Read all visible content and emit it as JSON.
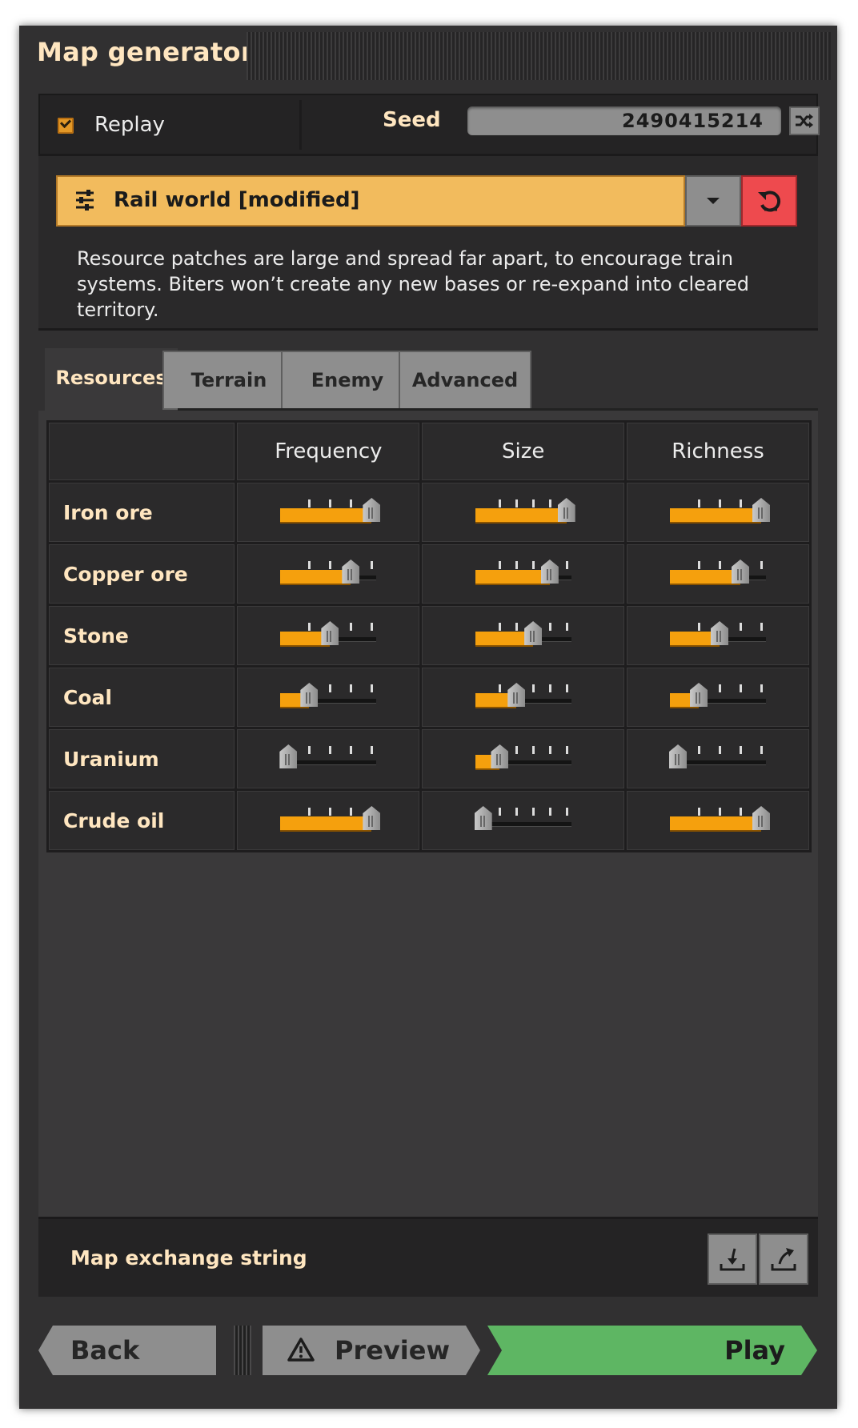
{
  "window": {
    "title": "Map generator"
  },
  "seed_row": {
    "replay_label": "Replay",
    "replay_checked": true,
    "seed_label": "Seed",
    "seed_value": "2490415214",
    "shuffle_icon": "shuffle-icon"
  },
  "preset": {
    "icon": "sliders-icon",
    "label": "Rail world [modified]",
    "dropdown_icon": "chevron-down-icon",
    "reset_icon": "reset-icon",
    "description": "Resource patches are large and spread far apart, to encourage train systems. Biters won’t create any new bases or re-expand into cleared territory."
  },
  "tabs": [
    {
      "label": "Resources",
      "active": true
    },
    {
      "label": "Terrain",
      "active": false
    },
    {
      "label": "Enemy",
      "active": false
    },
    {
      "label": "Advanced",
      "active": false
    }
  ],
  "resources": {
    "columns": [
      "Frequency",
      "Size",
      "Richness"
    ],
    "rows": [
      {
        "name": "Iron ore",
        "frequency": {
          "level": 4,
          "steps": 4
        },
        "size": {
          "level": 5,
          "steps": 5
        },
        "richness": {
          "level": 4,
          "steps": 4
        }
      },
      {
        "name": "Copper ore",
        "frequency": {
          "level": 3,
          "steps": 4
        },
        "size": {
          "level": 4,
          "steps": 5
        },
        "richness": {
          "level": 3,
          "steps": 4
        }
      },
      {
        "name": "Stone",
        "frequency": {
          "level": 2,
          "steps": 4
        },
        "size": {
          "level": 3,
          "steps": 5
        },
        "richness": {
          "level": 2,
          "steps": 4
        }
      },
      {
        "name": "Coal",
        "frequency": {
          "level": 1,
          "steps": 4
        },
        "size": {
          "level": 2,
          "steps": 5
        },
        "richness": {
          "level": 1,
          "steps": 4
        }
      },
      {
        "name": "Uranium",
        "frequency": {
          "level": 0,
          "steps": 4
        },
        "size": {
          "level": 1,
          "steps": 5
        },
        "richness": {
          "level": 0,
          "steps": 4
        }
      },
      {
        "name": "Crude oil",
        "frequency": {
          "level": 4,
          "steps": 4
        },
        "size": {
          "level": 0,
          "steps": 5
        },
        "richness": {
          "level": 4,
          "steps": 4
        }
      }
    ]
  },
  "exchange": {
    "label": "Map exchange string",
    "import_icon": "import-icon",
    "export_icon": "export-icon"
  },
  "buttons": {
    "back": "Back",
    "preview": "Preview",
    "preview_icon": "warning-icon",
    "play": "Play"
  },
  "colors": {
    "accent_orange": "#f5a00d",
    "preset_bar": "#f2bb5d",
    "reset_red": "#ee4a4e",
    "play_green": "#5eb663",
    "heading_text": "#ffe6c0"
  }
}
